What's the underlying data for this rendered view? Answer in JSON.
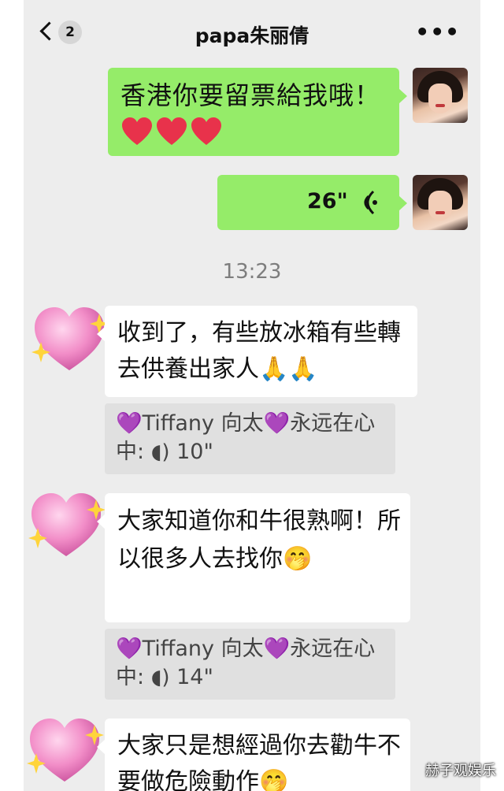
{
  "header": {
    "back_count": "2",
    "title": "papa朱丽倩"
  },
  "messages": {
    "m1_text": "香港你要留票給我哦！",
    "voice_duration": "26\"",
    "timestamp": "13:23",
    "m3_text": "收到了，有些放冰箱有些轉去供養出家人🙏🙏",
    "q1_name": "Tiffany 向太",
    "q1_tail": "永远在心",
    "q1_prefix": "中: ",
    "q1_duration": "10\"",
    "m4_text": "大家知道你和牛很熟啊！所以很多人去找你🤭",
    "q2_name": "Tiffany 向太",
    "q2_tail": "永远在心",
    "q2_prefix": "中: ",
    "q2_duration": "14\"",
    "m5_text": "大家只是想經過你去勸牛不要做危險動作🤭"
  },
  "watermark": "赫子观娱乐",
  "colors": {
    "green_bubble": "#95ec69",
    "white_bubble": "#ffffff",
    "background": "#ededed",
    "heart_pink": "#f28ec8",
    "sparkle": "#ffd43b"
  }
}
